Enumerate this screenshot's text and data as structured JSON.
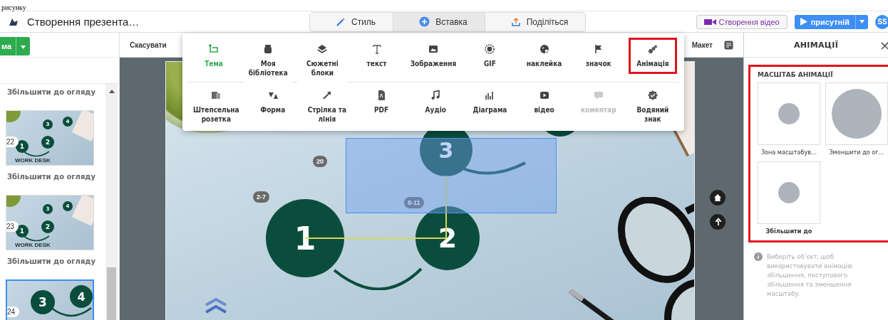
{
  "document_text": "рисунку",
  "app_bar": {
    "title": "Створення презента…",
    "modes": [
      {
        "label": "Стиль",
        "selected": false
      },
      {
        "label": "Вставка",
        "selected": true
      },
      {
        "label": "Поділіться",
        "selected": false
      }
    ],
    "video_button": "Створення відео",
    "present_button": "присутній",
    "avatar": "SS"
  },
  "left_toolbar": {
    "button": "ма"
  },
  "slides_panel": {
    "items": [
      {
        "kind": "label",
        "text": "Збільшити до огляду"
      },
      {
        "kind": "slide",
        "number": "22",
        "selected": false,
        "circles": [
          "1",
          "2",
          "3",
          "4"
        ],
        "caption": "WORK DESK"
      },
      {
        "kind": "label",
        "text": "Збільшити до огляду"
      },
      {
        "kind": "slide",
        "number": "23",
        "selected": false,
        "circles": [
          "1",
          "2",
          "3",
          "4"
        ],
        "caption": "WORK DESK"
      },
      {
        "kind": "label",
        "text": "Збільшити до огляду"
      },
      {
        "kind": "slide",
        "number": "24",
        "selected": true,
        "circles": [
          "3",
          "4"
        ]
      }
    ]
  },
  "editor_toolbar": {
    "undo": "Скасувати",
    "layout": "Макет"
  },
  "insert_menu": {
    "rows": [
      [
        {
          "label": "Тема",
          "selected": true,
          "disabled": false,
          "highlighted": false
        },
        {
          "label": "Моя бібліотека",
          "selected": false,
          "disabled": false,
          "highlighted": false
        },
        {
          "label": "Сюжетні блоки",
          "selected": false,
          "disabled": false,
          "highlighted": false
        },
        {
          "label": "текст",
          "selected": false,
          "disabled": false,
          "highlighted": false
        },
        {
          "label": "Зображення",
          "selected": false,
          "disabled": false,
          "highlighted": false
        },
        {
          "label": "GIF",
          "selected": false,
          "disabled": false,
          "highlighted": false
        },
        {
          "label": "наклейка",
          "selected": false,
          "disabled": false,
          "highlighted": false
        },
        {
          "label": "значок",
          "selected": false,
          "disabled": false,
          "highlighted": false
        },
        {
          "label": "Анімація",
          "selected": false,
          "disabled": false,
          "highlighted": true
        }
      ],
      [
        {
          "label": "Штепсельна розетка",
          "selected": false,
          "disabled": false,
          "highlighted": false
        },
        {
          "label": "Форма",
          "selected": false,
          "disabled": false,
          "highlighted": false
        },
        {
          "label": "Стрілка та лінія",
          "selected": false,
          "disabled": false,
          "highlighted": false
        },
        {
          "label": "PDF",
          "selected": false,
          "disabled": false,
          "highlighted": false
        },
        {
          "label": "Аудіо",
          "selected": false,
          "disabled": false,
          "highlighted": false
        },
        {
          "label": "Діаграма",
          "selected": false,
          "disabled": false,
          "highlighted": false
        },
        {
          "label": "відео",
          "selected": false,
          "disabled": false,
          "highlighted": false
        },
        {
          "label": "коментар",
          "selected": false,
          "disabled": true,
          "highlighted": false
        },
        {
          "label": "Водяний знак",
          "selected": false,
          "disabled": false,
          "highlighted": false
        }
      ]
    ]
  },
  "slide": {
    "circles": [
      "1",
      "2",
      "3"
    ],
    "badges": [
      "20",
      "2-7",
      "8-11"
    ]
  },
  "animation_panel": {
    "title": "АНІМАЦІЇ",
    "close": "×",
    "highlighted": true,
    "section_title": "МАСШТАБ АНІМАЦІЇ",
    "options": [
      {
        "kind": "zoom-area",
        "label": "Зона масштабув…"
      },
      {
        "kind": "zoom-out",
        "label": "Зменшити до ог…"
      },
      {
        "kind": "zoom-in",
        "label": "Збільшити до"
      }
    ],
    "hint": "Виберіть об’єкт, щоб використовувати анімацію збільшення, поступового збільшення та зменшення масштабу."
  }
}
